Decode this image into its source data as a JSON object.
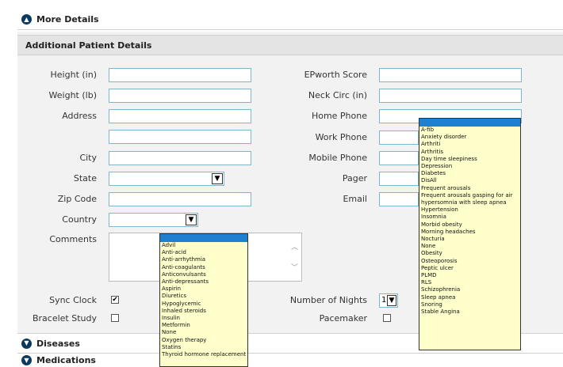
{
  "sections": {
    "more_details": "More Details",
    "additional": "Additional Patient Details",
    "diseases": "Diseases",
    "medications": "Medications"
  },
  "labels": {
    "height": "Height (in)",
    "weight": "Weight (lb)",
    "address": "Address",
    "city": "City",
    "state": "State",
    "zip": "Zip Code",
    "country": "Country",
    "comments": "Comments",
    "sync_clock": "Sync Clock",
    "bracelet_study": "Bracelet Study",
    "epworth": "EPworth Score",
    "neck": "Neck Circ (in)",
    "home_phone": "Home Phone",
    "work_phone": "Work Phone",
    "mobile_phone": "Mobile Phone",
    "pager": "Pager",
    "email": "Email",
    "nights": "Number of Nights",
    "pacemaker": "Pacemaker"
  },
  "values": {
    "nights": "1",
    "sync_clock_checked": "✔"
  },
  "medication_options": [
    "Advil",
    "Anti-acid",
    "Anti-arrhythmia",
    "Anti-coagulants",
    "Anticonvulsants",
    "Anti-depressants",
    "Aspirin",
    "Diuretics",
    "Hypoglycemic",
    "Inhaled steroids",
    "Insulin",
    "Metformin",
    "None",
    "Oxygen therapy",
    "Statins",
    "Thyroid hormone replacement"
  ],
  "disease_options": [
    "A-fib",
    "Anxiety disorder",
    "Arthriti",
    "Arthritis",
    "Day time sleepiness",
    "Depression",
    "Diabetes",
    "DisAll",
    "Frequent arousals",
    "Frequent arousals gasping for air",
    "hypersomnia with sleep apnea",
    "Hypertension",
    "Insomnia",
    "Morbid obesity",
    "Morning headaches",
    "Nocturia",
    "None",
    "Obesity",
    "Osteoporosis",
    "Peptic ulcer",
    "PLMD",
    "RLS",
    "Schizophrenia",
    "Sleep apnea",
    "Snoring",
    "Stable Angina"
  ],
  "colors": {
    "accent_blue": "#1f7fd0",
    "listbox_bg": "#ffffcc",
    "field_border": "#7fb6cc"
  }
}
